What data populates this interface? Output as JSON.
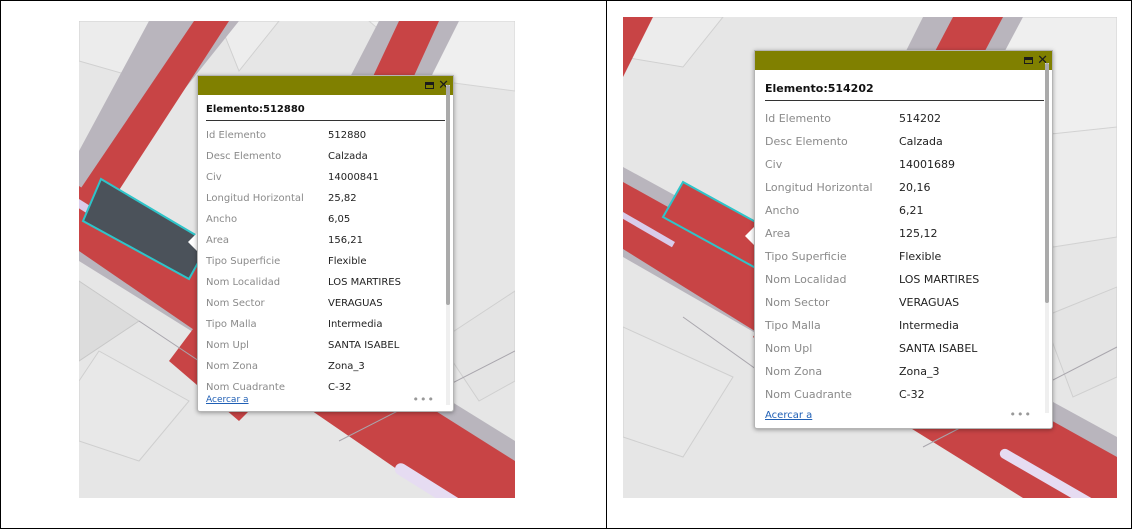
{
  "popup_left": {
    "title": "Elemento:512880",
    "rows": [
      {
        "key": "Id Elemento",
        "value": "512880"
      },
      {
        "key": "Desc Elemento",
        "value": "Calzada"
      },
      {
        "key": "Civ",
        "value": "14000841"
      },
      {
        "key": "Longitud Horizontal",
        "value": "25,82"
      },
      {
        "key": "Ancho",
        "value": "6,05"
      },
      {
        "key": "Area",
        "value": "156,21"
      },
      {
        "key": "Tipo Superficie",
        "value": "Flexible"
      },
      {
        "key": "Nom Localidad",
        "value": "LOS MARTIRES"
      },
      {
        "key": "Nom Sector",
        "value": "VERAGUAS"
      },
      {
        "key": "Tipo Malla",
        "value": "Intermedia"
      },
      {
        "key": "Nom Upl",
        "value": "SANTA ISABEL"
      },
      {
        "key": "Nom Zona",
        "value": "Zona_3"
      },
      {
        "key": "Nom Cuadrante",
        "value": "C-32"
      }
    ],
    "zoom_link": "Acercar a",
    "more": "•••"
  },
  "popup_right": {
    "title": "Elemento:514202",
    "rows": [
      {
        "key": "Id Elemento",
        "value": "514202"
      },
      {
        "key": "Desc Elemento",
        "value": "Calzada"
      },
      {
        "key": "Civ",
        "value": "14001689"
      },
      {
        "key": "Longitud Horizontal",
        "value": "20,16"
      },
      {
        "key": "Ancho",
        "value": "6,21"
      },
      {
        "key": "Area",
        "value": "125,12"
      },
      {
        "key": "Tipo Superficie",
        "value": "Flexible"
      },
      {
        "key": "Nom Localidad",
        "value": "LOS MARTIRES"
      },
      {
        "key": "Nom Sector",
        "value": "VERAGUAS"
      },
      {
        "key": "Tipo Malla",
        "value": "Intermedia"
      },
      {
        "key": "Nom Upl",
        "value": "SANTA ISABEL"
      },
      {
        "key": "Nom Zona",
        "value": "Zona_3"
      },
      {
        "key": "Nom Cuadrante",
        "value": "C-32"
      }
    ],
    "zoom_link": "Acercar a",
    "more": "•••"
  },
  "colors": {
    "road": "#c84445",
    "sidewalk": "#b9b5bd",
    "header": "#808000",
    "selection": "#2ec4c9",
    "selected_fill": "#4b525a"
  }
}
